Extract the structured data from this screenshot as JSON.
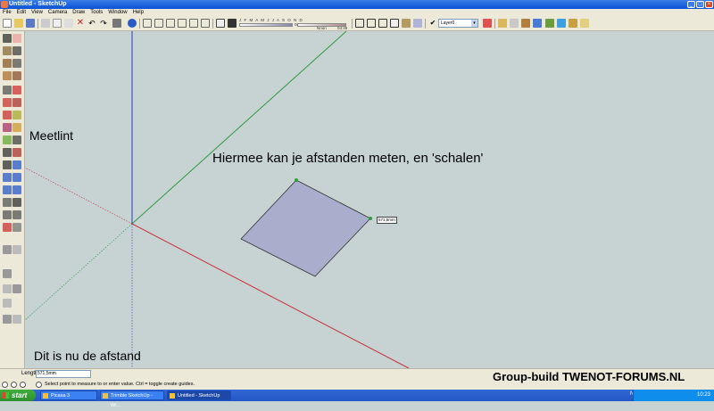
{
  "window": {
    "title": "Untitled - SketchUp"
  },
  "menu": [
    "File",
    "Edit",
    "View",
    "Camera",
    "Draw",
    "Tools",
    "Window",
    "Help"
  ],
  "toolbar": {
    "shadow_months": "J F M A M J J A S O N D",
    "time_start": "06:43",
    "time_noon": "Noon",
    "time_end": "04:46",
    "layer": "Layer0"
  },
  "canvas": {
    "label_tool": "Meetlint",
    "label_desc": "Hiermee kan je afstanden meten, en 'schalen'",
    "label_distance": "Dit is nu de afstand",
    "dimension": "571,5mm",
    "face_color": "#a9aecc",
    "axis_colors": {
      "red": "#c8303a",
      "green": "#2f9a40",
      "blue": "#2a3bc0"
    }
  },
  "measurements": {
    "label": "Length",
    "value": "571,5mm"
  },
  "status": {
    "message": "Select point to measure to or enter value.  Ctrl = toggle create guides."
  },
  "credit": "Group-build TWENOT-FORUMS.NL",
  "taskbar": {
    "start": "start",
    "tasks": [
      "Picasa 3",
      "Trimble SketchUp - Wi...",
      "Untitled - SketchUp"
    ],
    "language": "NL",
    "clock": "10:23"
  }
}
